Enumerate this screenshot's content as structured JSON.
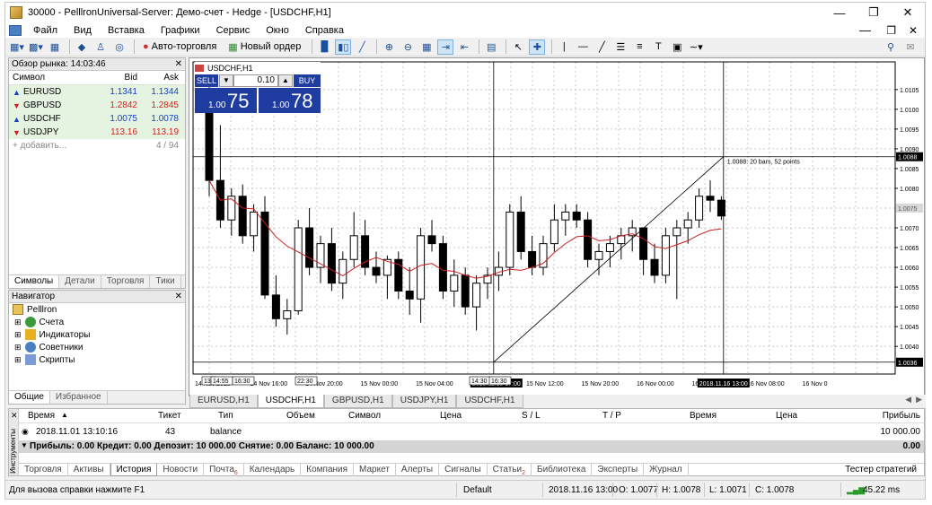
{
  "window": {
    "title": "30000 - PelllronUniversal-Server: Демо-счет - Hedge - [USDCHF,H1]"
  },
  "menu": [
    "Файл",
    "Вид",
    "Вставка",
    "Графики",
    "Сервис",
    "Окно",
    "Справка"
  ],
  "toolbar": {
    "auto_trading": "Авто-торговля",
    "new_order": "Новый ордер"
  },
  "market_watch": {
    "title": "Обзор рынка: 14:03:46",
    "col_symbol": "Символ",
    "col_bid": "Bid",
    "col_ask": "Ask",
    "rows": [
      {
        "symbol": "EURUSD",
        "bid": "1.1341",
        "ask": "1.1344",
        "color": "#1a3fc4",
        "icon": "up-arrow-icon"
      },
      {
        "symbol": "GBPUSD",
        "bid": "1.2842",
        "ask": "1.2845",
        "color": "#d02020",
        "icon": "down-arrow-icon"
      },
      {
        "symbol": "USDCHF",
        "bid": "1.0075",
        "ask": "1.0078",
        "color": "#1a3fc4",
        "icon": "up-arrow-icon"
      },
      {
        "symbol": "USDJPY",
        "bid": "113.16",
        "ask": "113.19",
        "color": "#d02020",
        "icon": "down-arrow-icon"
      }
    ],
    "add_label": "+ добавить...",
    "count": "4 / 94",
    "tabs": [
      "Символы",
      "Детали",
      "Торговля",
      "Тики"
    ]
  },
  "navigator": {
    "title": "Навигатор",
    "root": "Pelllron",
    "items": [
      "Счета",
      "Индикаторы",
      "Советники",
      "Скрипты"
    ],
    "tabs": [
      "Общие",
      "Избранное"
    ]
  },
  "chart": {
    "symbol_label": "USDCHF,H1",
    "one_click": {
      "sell": "SELL",
      "buy": "BUY",
      "volume": "0.10",
      "sell_lot": "1.00",
      "sell_price": "75",
      "buy_lot": "1.00",
      "buy_price": "78"
    },
    "measure_label": "1.0088: 20 bars, 52 points",
    "crosshair_price_top": "1.0088",
    "crosshair_price_bottom": "1.0036",
    "bid_price": "1.0075",
    "crosshair_time": "2018.11.15 17:00",
    "crosshair_time_end": "2018.11.16 13:00",
    "time_ticks": [
      "14 Nov 2018",
      "14 Nov 16:00",
      "14 Nov 20:00",
      "15 Nov 00:00",
      "15 Nov 04:00",
      "15 Nov 08:00",
      "15 Nov 12:00",
      "15 Nov 20:00",
      "16 Nov 00:00",
      "16 Nov 04:00",
      "16 Nov 08:00",
      "16 Nov 0"
    ],
    "small_time_labels": [
      "13:",
      "14:55",
      "16:30",
      "22:30",
      "14:30",
      "16:30"
    ],
    "price_ticks": [
      "1.0105",
      "1.0100",
      "1.0095",
      "1.0090",
      "1.0085",
      "1.0080",
      "1.0070",
      "1.0065",
      "1.0060",
      "1.0055",
      "1.0050",
      "1.0045",
      "1.0040"
    ],
    "tabs": [
      "EURUSD,H1",
      "USDCHF,H1",
      "GBPUSD,H1",
      "USDJPY,H1",
      "USDCHF,H1"
    ]
  },
  "chart_data": {
    "type": "candlestick",
    "ylim": [
      1.0033,
      1.0112
    ],
    "series": [
      {
        "name": "candles",
        "values": [
          [
            1.0102,
            1.0108,
            1.0078,
            1.0082
          ],
          [
            1.0082,
            1.0096,
            1.007,
            1.0072
          ],
          [
            1.0072,
            1.008,
            1.0068,
            1.0078
          ],
          [
            1.0078,
            1.0081,
            1.0066,
            1.0068
          ],
          [
            1.0068,
            1.0076,
            1.0064,
            1.0074
          ],
          [
            1.0074,
            1.0078,
            1.0052,
            1.0053
          ],
          [
            1.0053,
            1.0058,
            1.0045,
            1.0047
          ],
          [
            1.0047,
            1.0052,
            1.0043,
            1.0049
          ],
          [
            1.0049,
            1.0072,
            1.0048,
            1.007
          ],
          [
            1.007,
            1.0075,
            1.0058,
            1.006
          ],
          [
            1.006,
            1.0068,
            1.0056,
            1.0066
          ],
          [
            1.0066,
            1.007,
            1.0054,
            1.0056
          ],
          [
            1.0056,
            1.0064,
            1.0052,
            1.0062
          ],
          [
            1.0062,
            1.0074,
            1.006,
            1.0068
          ],
          [
            1.0068,
            1.0072,
            1.0058,
            1.006
          ],
          [
            1.006,
            1.0064,
            1.0056,
            1.0058
          ],
          [
            1.0058,
            1.0063,
            1.0052,
            1.0062
          ],
          [
            1.0062,
            1.0064,
            1.0052,
            1.0054
          ],
          [
            1.0054,
            1.006,
            1.0048,
            1.0052
          ],
          [
            1.0052,
            1.007,
            1.0046,
            1.0068
          ],
          [
            1.0068,
            1.0072,
            1.0064,
            1.0066
          ],
          [
            1.0066,
            1.0068,
            1.0052,
            1.0054
          ],
          [
            1.0054,
            1.0062,
            1.005,
            1.0058
          ],
          [
            1.0058,
            1.006,
            1.0048,
            1.005
          ],
          [
            1.005,
            1.0058,
            1.0044,
            1.0056
          ],
          [
            1.0056,
            1.006,
            1.0052,
            1.0058
          ],
          [
            1.0058,
            1.0064,
            1.0054,
            1.006
          ],
          [
            1.006,
            1.0076,
            1.0058,
            1.0074
          ],
          [
            1.0074,
            1.0078,
            1.0062,
            1.0064
          ],
          [
            1.0064,
            1.0068,
            1.0058,
            1.006
          ],
          [
            1.006,
            1.0068,
            1.0058,
            1.0066
          ],
          [
            1.0066,
            1.0076,
            1.0064,
            1.0072
          ],
          [
            1.0072,
            1.0076,
            1.0068,
            1.0074
          ],
          [
            1.0074,
            1.0076,
            1.007,
            1.0072
          ],
          [
            1.0072,
            1.0074,
            1.006,
            1.0062
          ],
          [
            1.0062,
            1.0066,
            1.0058,
            1.0064
          ],
          [
            1.0064,
            1.0068,
            1.006,
            1.0066
          ],
          [
            1.0066,
            1.007,
            1.0062,
            1.0068
          ],
          [
            1.0068,
            1.0072,
            1.0064,
            1.007
          ],
          [
            1.007,
            1.007,
            1.0058,
            1.0062
          ],
          [
            1.0062,
            1.0066,
            1.0056,
            1.0058
          ],
          [
            1.0058,
            1.007,
            1.0056,
            1.0068
          ],
          [
            1.0068,
            1.0072,
            1.0052,
            1.007
          ],
          [
            1.007,
            1.0074,
            1.0066,
            1.0072
          ],
          [
            1.0072,
            1.008,
            1.007,
            1.0078
          ],
          [
            1.0078,
            1.0082,
            1.0074,
            1.0077
          ],
          [
            1.0077,
            1.0078,
            1.0072,
            1.0073
          ]
        ]
      }
    ]
  },
  "terminal": {
    "side_label": "Инструменты",
    "headers": [
      "Время",
      "Тикет",
      "Тип",
      "Объем",
      "Символ",
      "Цена",
      "S / L",
      "T / P",
      "Время",
      "Цена",
      "Прибыль"
    ],
    "row": {
      "time": "2018.11.01 13:10:16",
      "ticket": "43",
      "type": "balance",
      "profit": "10 000.00"
    },
    "summary": "Прибыль: 0.00  Кредит: 0.00  Депозит: 10 000.00  Снятие: 0.00  Баланс: 10 000.00",
    "summary_value": "0.00",
    "tabs": [
      "Торговля",
      "Активы",
      "История",
      "Новости",
      "Почта",
      "Календарь",
      "Компания",
      "Маркет",
      "Алерты",
      "Сигналы",
      "Статьи",
      "Библиотека",
      "Эксперты",
      "Журнал"
    ],
    "mail_count": "6",
    "articles_count": "2",
    "strategy_tester": "Тестер стратегий"
  },
  "status": {
    "help": "Для вызова справки нажмите F1",
    "profile": "Default",
    "time": "2018.11.16 13:00",
    "open": "O: 1.0077",
    "high": "H: 1.0078",
    "low": "L: 1.0071",
    "close": "C: 1.0078",
    "ping": "45.22 ms"
  }
}
